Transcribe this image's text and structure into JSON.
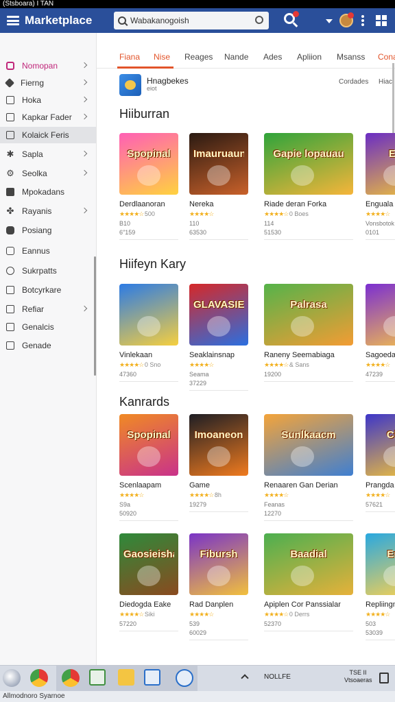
{
  "status_bar": {
    "text": "(Stsboara) I  TAN"
  },
  "app": {
    "title": "Marketplace",
    "search": {
      "value": "Wabakanogoish",
      "placeholder": "Search"
    }
  },
  "sidebar": {
    "items": [
      {
        "label": "Nomopan",
        "icon": "diamond-icon",
        "chevron": true
      },
      {
        "label": "Fierng",
        "icon": "tag-icon",
        "chevron": true
      },
      {
        "label": "Hoka",
        "icon": "window-icon",
        "chevron": true
      },
      {
        "label": "Kapkar Fader",
        "icon": "folder-icon",
        "chevron": true
      },
      {
        "label": "Kolaick Feris",
        "icon": "image-icon",
        "chevron": false
      },
      {
        "label": "Sapla",
        "icon": "star-icon",
        "chevron": true
      },
      {
        "label": "Seolka",
        "icon": "gear-icon",
        "chevron": true
      },
      {
        "label": "Mpokadans",
        "icon": "puzzle-icon",
        "chevron": false
      },
      {
        "label": "Rayanis",
        "icon": "sparkle-icon",
        "chevron": true
      },
      {
        "label": "Posiang",
        "icon": "gamepad-icon",
        "chevron": false
      },
      {
        "label": "Eannus",
        "icon": "bag-icon",
        "chevron": false
      },
      {
        "label": "Sukrpatts",
        "icon": "clock-icon",
        "chevron": false
      },
      {
        "label": "Botcyrkare",
        "icon": "monitor-icon",
        "chevron": false
      },
      {
        "label": "Refiar",
        "icon": "list-icon",
        "chevron": true
      },
      {
        "label": "Genalcis",
        "icon": "doc-icon",
        "chevron": false
      },
      {
        "label": "Genade",
        "icon": "square-icon",
        "chevron": false
      }
    ]
  },
  "tabs": [
    "Fiana",
    "Nise",
    "Reages",
    "Nande",
    "Ades",
    "Apliion",
    "Msanss",
    "Cona"
  ],
  "featured": {
    "title": "Hnagbekes",
    "subtitle": "eiot",
    "meta": "Cordades",
    "meta2": "Hiac"
  },
  "sections": [
    {
      "title": "Hiiburran"
    },
    {
      "title": "Hiifeyn Kary"
    },
    {
      "title": "Kanrards"
    },
    {
      "title": ""
    }
  ],
  "rows": [
    [
      {
        "name": "Derdlaanoran",
        "art": "Spopinal",
        "rating_text": "500",
        "sub": "B10",
        "count": "6″159",
        "theme": "pink"
      },
      {
        "name": "Nereka",
        "art": "Imauruaun",
        "rating_text": "",
        "sub": "110",
        "count": "63530",
        "theme": "dark"
      },
      {
        "name": "Riade deran  Forka",
        "art": "Gapie lopauau",
        "rating_text": "0 Boes",
        "sub": "114",
        "count": "51530",
        "theme": "jungle"
      },
      {
        "name": "Enguala",
        "art": "Ell",
        "rating_text": "",
        "sub": "Vonsbotok",
        "count": "0101",
        "theme": "purple"
      }
    ],
    [
      {
        "name": "Vinlekaan",
        "art": "",
        "rating_text": "0 Sno",
        "sub": "",
        "count": "47360",
        "theme": "blue"
      },
      {
        "name": "Seaklainsnap",
        "art": "GLAVASIEK",
        "rating_text": "",
        "sub": "Seama",
        "count": "37229",
        "theme": "red"
      },
      {
        "name": "Raneny Seemabiaga",
        "art": "Palrasa",
        "rating_text": "& Sans",
        "sub": "",
        "count": "19200",
        "theme": "park"
      },
      {
        "name": "Sagoeda",
        "art": "",
        "rating_text": "",
        "sub": "",
        "count": "47239",
        "theme": "violet"
      }
    ],
    [
      {
        "name": "Scenlaapam",
        "art": "Spopinal",
        "rating_text": "",
        "sub": "S9a",
        "count": "50920",
        "theme": "orange"
      },
      {
        "name": "Game",
        "art": "Imoaneon",
        "rating_text": "8h",
        "sub": "",
        "count": "19279",
        "theme": "metal"
      },
      {
        "name": "Renaaren Gan Derian",
        "art": "Sunlkaacm",
        "rating_text": "",
        "sub": "Feanas",
        "count": "12270",
        "theme": "crowd"
      },
      {
        "name": "Prangda",
        "art": "Clo",
        "rating_text": "",
        "sub": "",
        "count": "57621",
        "theme": "indigo"
      }
    ],
    [
      {
        "name": "Diedogda Eake",
        "art": "Gaosieisha",
        "rating_text": "Siki",
        "sub": "",
        "count": "57220",
        "theme": "bear"
      },
      {
        "name": "Rad Danplen",
        "art": "Fibursh",
        "rating_text": "",
        "sub": "539",
        "count": "60029",
        "theme": "violet2"
      },
      {
        "name": "Apiplen Cor Panssialan",
        "art": "Baadial",
        "rating_text": "0 Derrs",
        "sub": "",
        "count": "52370",
        "theme": "meadow"
      },
      {
        "name": "Repliingn",
        "art": "Em",
        "rating_text": "",
        "sub": "503",
        "count": "53039",
        "theme": "sky"
      }
    ]
  ],
  "taskbar": {
    "tray_text": "NOLLFE",
    "time": "TSE II",
    "date": "Vtsoaeras"
  },
  "footer": {
    "text": "Allmodnoro  Syarnoe"
  }
}
